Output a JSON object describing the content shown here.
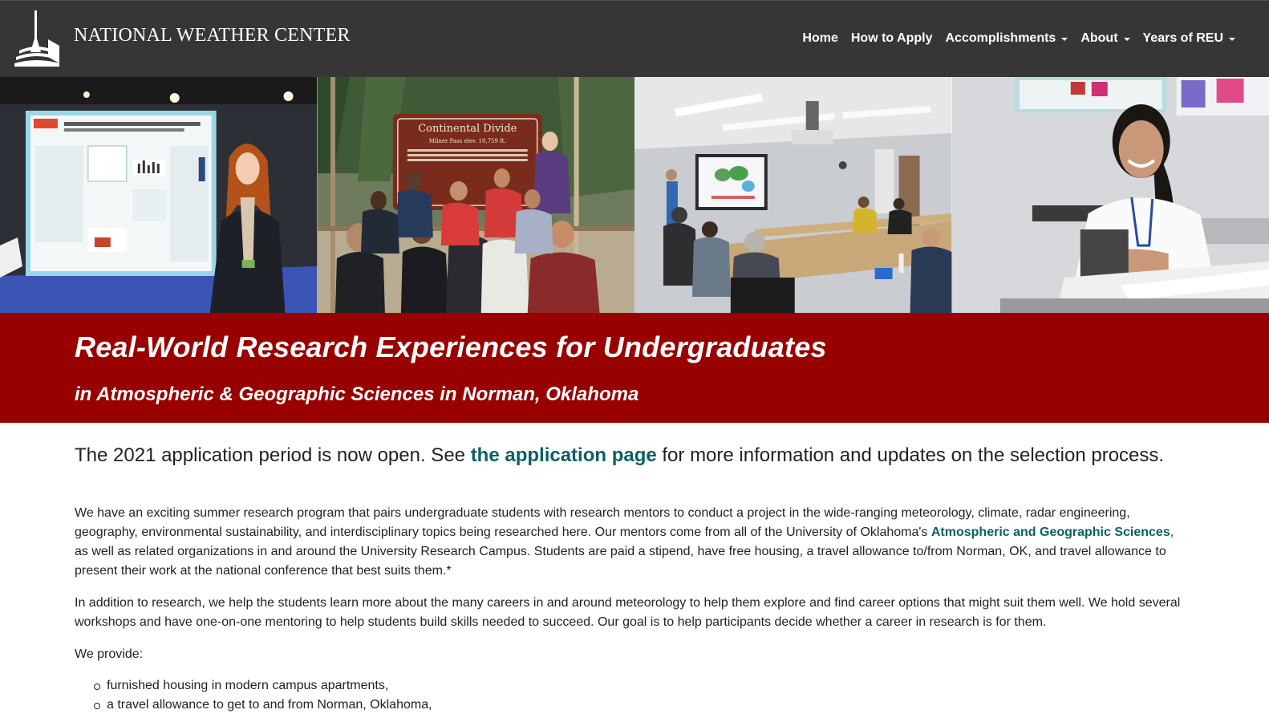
{
  "header": {
    "brand": "NATIONAL WEATHER CENTER",
    "nav": [
      {
        "label": "Home",
        "dropdown": false
      },
      {
        "label": "How to Apply",
        "dropdown": false
      },
      {
        "label": "Accomplishments",
        "dropdown": true
      },
      {
        "label": "About",
        "dropdown": true
      },
      {
        "label": "Years of REU",
        "dropdown": true
      }
    ]
  },
  "photo_strip": {
    "photo2_sign_title": "Continental Divide",
    "photo2_sign_subtitle": "Milner Pass     elev. 10,759 ft."
  },
  "hero": {
    "title": "Real-World Research Experiences for Undergraduates",
    "subtitle": "in Atmospheric & Geographic Sciences in Norman, Oklahoma"
  },
  "main": {
    "lead_before": "The 2021 application period is now open. See ",
    "lead_link": "the application page",
    "lead_after": " for more information and updates on the selection process.",
    "para1_before": "We have an exciting summer research program that pairs undergraduate students with research mentors to conduct a project in the wide-ranging meteorology, climate, radar engineering, geography, environmental sustainability, and interdisciplinary topics being researched here. Our mentors come from all of the University of Oklahoma's ",
    "para1_link": "Atmospheric and Geographic Sciences",
    "para1_after": ", as well as related organizations in and around the University Research Campus. Students are paid a stipend, have free housing, a travel allowance to/from Norman, OK, and travel allowance to present their work at the national conference that best suits them.*",
    "para2": "In addition to research, we help the students learn more about the many careers in and around meteorology to help them explore and find career options that might suit them well. We hold several workshops and have one-on-one mentoring to help students build skills needed to succeed. Our goal is to help participants decide whether a career in research is for them.",
    "para3": "We provide:",
    "provide_list": [
      "furnished housing in modern campus apartments,",
      "a travel allowance to get to and from Norman, Oklahoma,"
    ]
  },
  "colors": {
    "navbar_bg": "#363636",
    "hero_bg": "#990000",
    "link": "#0b5f66"
  }
}
